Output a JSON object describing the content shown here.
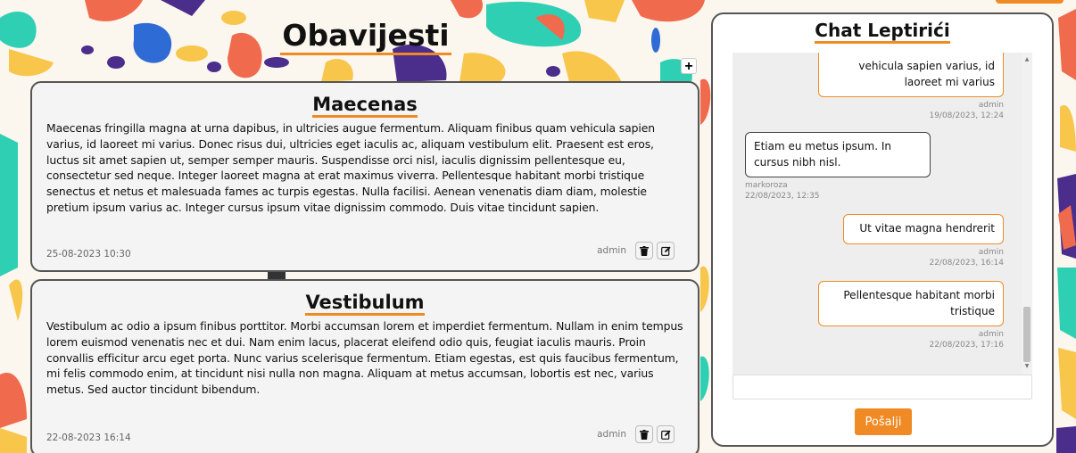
{
  "page": {
    "title": "Obavijesti",
    "add_label": "+"
  },
  "posts": [
    {
      "title": "Maecenas",
      "body": "Maecenas fringilla magna at urna dapibus, in ultricies augue fermentum. Aliquam finibus quam vehicula sapien varius, id laoreet mi varius. Donec risus dui, ultricies eget iaculis ac, aliquam vestibulum elit. Praesent est eros, luctus sit amet sapien ut, semper semper mauris. Suspendisse orci nisl, iaculis dignissim pellentesque eu, consectetur sed neque. Integer laoreet magna at erat maximus viverra. Pellentesque habitant morbi tristique senectus et netus et malesuada fames ac turpis egestas. Nulla facilisi. Aenean venenatis diam diam, molestie pretium ipsum varius ac. Integer cursus ipsum vitae dignissim commodo. Duis vitae tincidunt sapien.",
      "date": "25-08-2023 10:30",
      "author": "admin"
    },
    {
      "title": "Vestibulum",
      "body": "Vestibulum ac odio a ipsum finibus porttitor. Morbi accumsan lorem et imperdiet fermentum. Nullam in enim tempus lorem euismod venenatis nec et dui. Nam enim lacus, placerat eleifend odio quis, feugiat iaculis mauris. Proin convallis efficitur arcu eget porta. Nunc varius scelerisque fermentum. Etiam egestas, est quis faucibus fermentum, mi felis commodo enim, at tincidunt nisi nulla non magna. Aliquam at metus accumsan, lobortis est nec, varius metus. Sed auctor tincidunt bibendum.",
      "date": "22-08-2023 16:14",
      "author": "admin"
    }
  ],
  "chat": {
    "title": "Chat Leptirići",
    "messages": [
      {
        "text": "vehicula sapien varius, id laoreet mi varius",
        "author": "admin",
        "time": "19/08/2023, 12:24",
        "side": "right"
      },
      {
        "text": "Etiam eu metus ipsum. In cursus nibh nisl.",
        "author": "markoroza",
        "time": "22/08/2023, 12:35",
        "side": "left"
      },
      {
        "text": "Ut vitae magna hendrerit",
        "author": "admin",
        "time": "22/08/2023, 16:14",
        "side": "right"
      },
      {
        "text": "Pellentesque habitant morbi tristique",
        "author": "admin",
        "time": "22/08/2023, 17:16",
        "side": "right"
      }
    ],
    "input_value": "",
    "send_label": "Pošalji"
  },
  "icons": {
    "delete": "trash-icon",
    "edit": "edit-icon",
    "add": "plus-icon"
  },
  "colors": {
    "accent": "#f08a24",
    "card_bg": "#f4f4f4",
    "border": "#555555"
  }
}
